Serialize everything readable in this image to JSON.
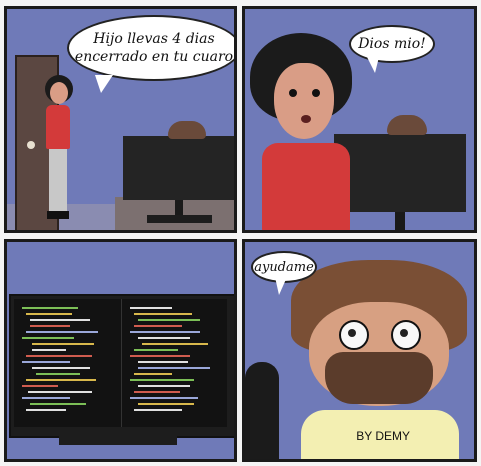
{
  "panels": [
    {
      "speech": "Hijo llevas 4 dias\nencerrado en tu cuaro"
    },
    {
      "speech": "Dios mio!"
    },
    {
      "speech": ""
    },
    {
      "speech": "ayudame"
    }
  ],
  "credit": "BY DEMY",
  "colors": {
    "wall": "#6f7ab8",
    "door": "#5b4741",
    "mother_shirt": "#d33a3a",
    "monitor": "#242424",
    "code_bg": "#121212",
    "son_shirt": "#f3efb2"
  }
}
